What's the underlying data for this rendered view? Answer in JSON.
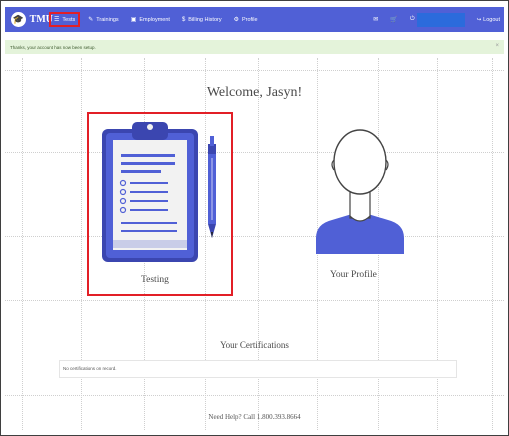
{
  "brand": {
    "name": "TMU",
    "logo_icon": "graduation-cap-icon"
  },
  "nav": {
    "items": [
      {
        "label": "Tests",
        "icon": "list-icon",
        "active": true
      },
      {
        "label": "Trainings",
        "icon": "tools-icon"
      },
      {
        "label": "Employment",
        "icon": "briefcase-icon"
      },
      {
        "label": "Billing History",
        "icon": "dollar-icon"
      },
      {
        "label": "Profile",
        "icon": "gear-icon"
      }
    ],
    "right_icons": [
      "envelope-icon",
      "cart-icon",
      "power-icon"
    ],
    "logout_label": "Logout"
  },
  "alert": {
    "message": "Thanks, your account has now been setup.",
    "close": "×"
  },
  "main": {
    "welcome": "Welcome, Jasyn!",
    "cards": [
      {
        "label": "Testing",
        "icon": "clipboard-icon"
      },
      {
        "label": "Your Profile",
        "icon": "user-silhouette-icon"
      }
    ],
    "certifications_title": "Your Certifications",
    "certifications_empty": "No certifications on record.",
    "help": "Need Help? Call 1.800.393.8664"
  },
  "colors": {
    "navbar": "#5060d6",
    "highlight": "#e21f26",
    "alert_bg": "#e4f3da",
    "illustration": "#5060d6"
  }
}
